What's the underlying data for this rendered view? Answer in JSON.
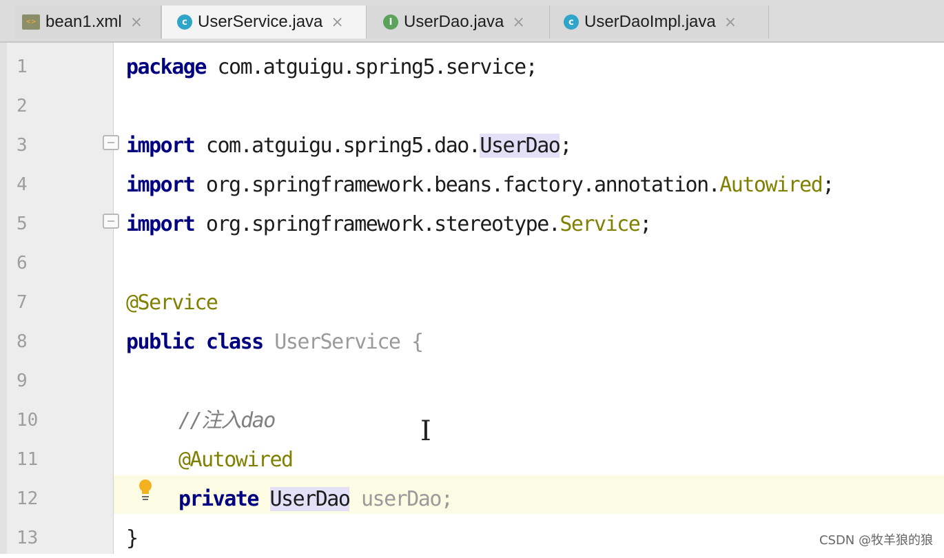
{
  "tabs": [
    {
      "label": "bean1.xml",
      "icon": "xml-file-icon",
      "active": false
    },
    {
      "label": "UserService.java",
      "icon": "class-icon",
      "active": true
    },
    {
      "label": "UserDao.java",
      "icon": "interface-icon",
      "active": false
    },
    {
      "label": "UserDaoImpl.java",
      "icon": "class-icon",
      "active": false
    }
  ],
  "tab_close_glyph": "×",
  "icon_letters": {
    "class": "c",
    "interface": "I",
    "xml": "<>"
  },
  "line_numbers": [
    "1",
    "2",
    "3",
    "4",
    "5",
    "6",
    "7",
    "8",
    "9",
    "10",
    "11",
    "12",
    "13"
  ],
  "code": {
    "l1": {
      "kw": "package",
      "rest": " com.atguigu.spring5.service;"
    },
    "l3": {
      "kw": "import",
      "pkg": " com.atguigu.spring5.dao.",
      "cls": "UserDao",
      "end": ";"
    },
    "l4": {
      "kw": "import",
      "pkg": " org.springframework.beans.factory.annotation.",
      "cls": "Autowired",
      "end": ";"
    },
    "l5": {
      "kw": "import",
      "pkg": " org.springframework.stereotype.",
      "cls": "Service",
      "end": ";"
    },
    "l7": {
      "ann": "@Service"
    },
    "l8": {
      "kw": "public class",
      "name": " UserService",
      "brace": " {"
    },
    "l10": {
      "comment": "//注入dao"
    },
    "l11": {
      "ann": "@Autowired"
    },
    "l12": {
      "kw": "private",
      "type": "UserDao",
      "var": " userDao;"
    },
    "l13": {
      "brace": "}"
    }
  },
  "caret_glyph": "I",
  "watermark": "CSDN @牧羊狼的狼",
  "colors": {
    "keyword": "#000080",
    "annotation": "#808000",
    "comment": "#808080",
    "current_line": "#fcfbe4",
    "reference_highlight": "#e4e0f7"
  }
}
